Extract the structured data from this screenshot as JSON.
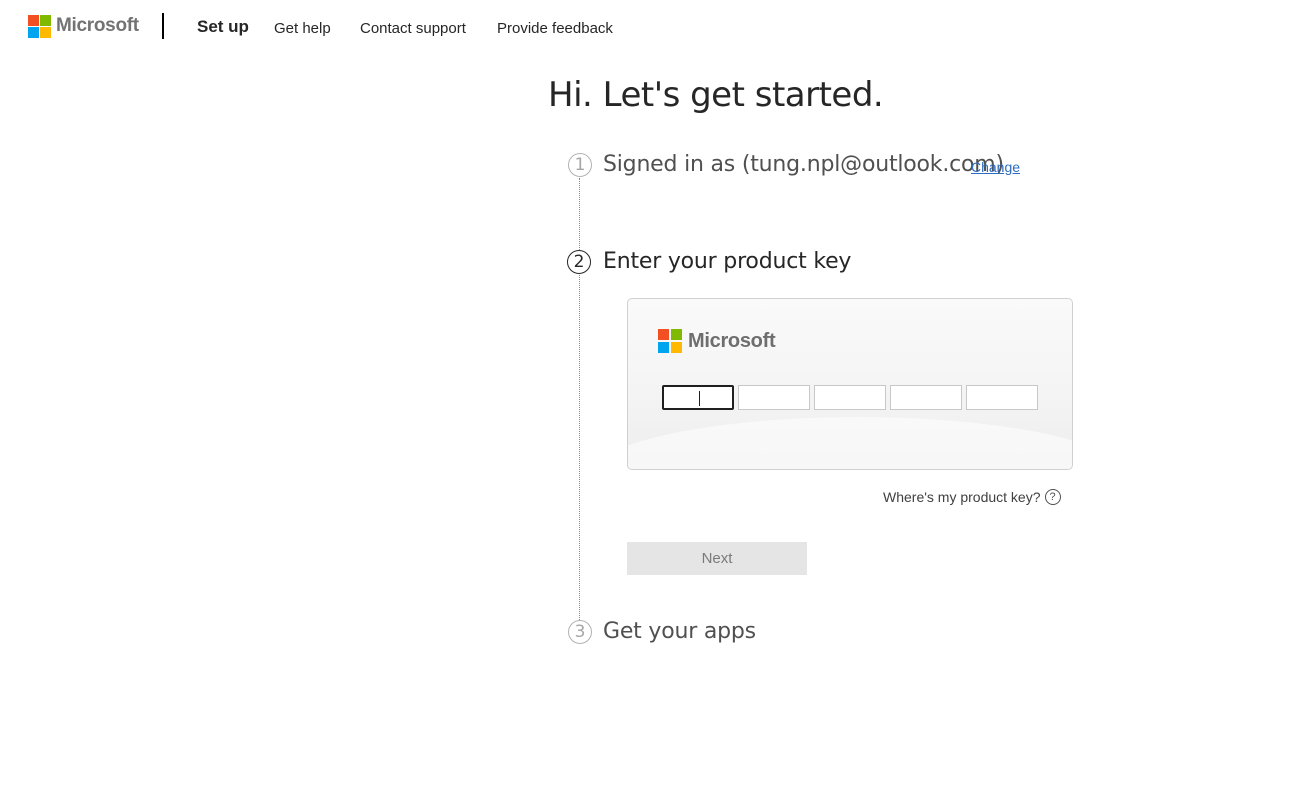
{
  "header": {
    "brand": "Microsoft",
    "title": "Set up",
    "links": [
      "Get help",
      "Contact support",
      "Provide feedback"
    ]
  },
  "logo_colors": [
    "#f25022",
    "#7fba00",
    "#00a4ef",
    "#ffb900"
  ],
  "main": {
    "title": "Hi. Let's get started.",
    "steps": [
      {
        "number": "1",
        "label": "Signed in as (tung.npl@outlook.com)",
        "action": "Change",
        "state": "completed"
      },
      {
        "number": "2",
        "label": "Enter your product key",
        "state": "active"
      },
      {
        "number": "3",
        "label": "Get your apps",
        "state": "pending"
      }
    ],
    "product_key": {
      "brand": "Microsoft",
      "values": [
        "",
        "",
        "",
        "",
        ""
      ],
      "help_text": "Where's my product key?",
      "help_icon": "?"
    },
    "next_label": "Next"
  },
  "colors": {
    "link": "#2d6cc0",
    "button_disabled_bg": "#e5e5e5",
    "button_disabled_text": "#7a7a7a"
  }
}
